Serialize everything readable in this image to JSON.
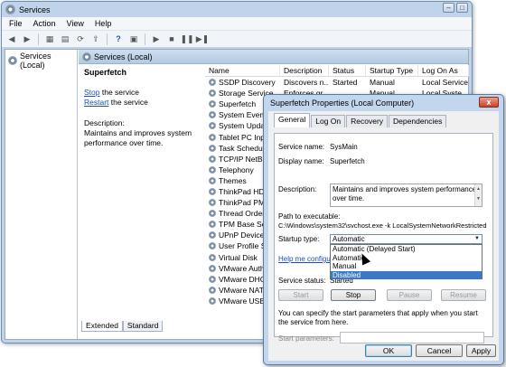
{
  "services_window": {
    "title": "Services",
    "menu": [
      "File",
      "Action",
      "View",
      "Help"
    ],
    "tree_item": "Services (Local)",
    "panel_header": "Services (Local)",
    "selected_service": "Superfetch",
    "stop_link": "Stop",
    "stop_suffix": " the service",
    "restart_link": "Restart",
    "restart_suffix": " the service",
    "description_label": "Description:",
    "description_text": "Maintains and improves system performance over time.",
    "columns": [
      "Name",
      "Description",
      "Status",
      "Startup Type",
      "Log On As"
    ],
    "rows": [
      [
        "SSDP Discovery",
        "Discovers n...",
        "Started",
        "Manual",
        "Local Service"
      ],
      [
        "Storage Service",
        "Enforces gr...",
        "",
        "Manual",
        "Local Syste..."
      ],
      [
        "Superfetch",
        "",
        "",
        "",
        ""
      ],
      [
        "System Event No",
        "",
        "",
        "",
        ""
      ],
      [
        "System Update",
        "",
        "",
        "",
        ""
      ],
      [
        "Tablet PC Input",
        "",
        "",
        "",
        ""
      ],
      [
        "Task Scheduler",
        "",
        "",
        "",
        ""
      ],
      [
        "TCP/IP NetBIOS",
        "",
        "",
        "",
        ""
      ],
      [
        "Telephony",
        "",
        "",
        "",
        ""
      ],
      [
        "Themes",
        "",
        "",
        "",
        ""
      ],
      [
        "ThinkPad HDD A",
        "",
        "",
        "",
        ""
      ],
      [
        "ThinkPad PM Se",
        "",
        "",
        "",
        ""
      ],
      [
        "Thread Ordering",
        "",
        "",
        "",
        ""
      ],
      [
        "TPM Base Servic",
        "",
        "",
        "",
        ""
      ],
      [
        "UPnP Device Ho",
        "",
        "",
        "",
        ""
      ],
      [
        "User Profile Ser",
        "",
        "",
        "",
        ""
      ],
      [
        "Virtual Disk",
        "",
        "",
        "",
        ""
      ],
      [
        "VMware Authori",
        "",
        "",
        "",
        ""
      ],
      [
        "VMware DHCP S",
        "",
        "",
        "",
        ""
      ],
      [
        "VMware NAT Ser",
        "",
        "",
        "",
        ""
      ],
      [
        "VMware USB Arb",
        "",
        "",
        "",
        ""
      ]
    ],
    "bottom_tabs": [
      "Extended",
      "Standard"
    ]
  },
  "dialog": {
    "title": "Superfetch Properties (Local Computer)",
    "close_label": "x",
    "tabs": [
      "General",
      "Log On",
      "Recovery",
      "Dependencies"
    ],
    "service_name_label": "Service name:",
    "service_name": "SysMain",
    "display_name_label": "Display name:",
    "display_name": "Superfetch",
    "description_label": "Description:",
    "description": "Maintains and improves system performance over time.",
    "path_label": "Path to executable:",
    "path": "C:\\Windows\\system32\\svchost.exe -k LocalSystemNetworkRestricted",
    "startup_type_label": "Startup type:",
    "startup_type_value": "Automatic",
    "startup_options": [
      "Automatic (Delayed Start)",
      "Automatic",
      "Manual",
      "Disabled"
    ],
    "selected_option": "Disabled",
    "help_link": "Help me configure s",
    "service_status_label": "Service status:",
    "service_status": "Started",
    "buttons": {
      "start": "Start",
      "stop": "Stop",
      "pause": "Pause",
      "resume": "Resume"
    },
    "params_text": "You can specify the start parameters that apply when you start the service from here.",
    "start_params_label": "Start parameters:",
    "ok": "OK",
    "cancel": "Cancel",
    "apply": "Apply"
  },
  "colors": {
    "window_frame": "#bfd4ea",
    "link": "#1a4fb3",
    "selection": "#3a79c8"
  }
}
